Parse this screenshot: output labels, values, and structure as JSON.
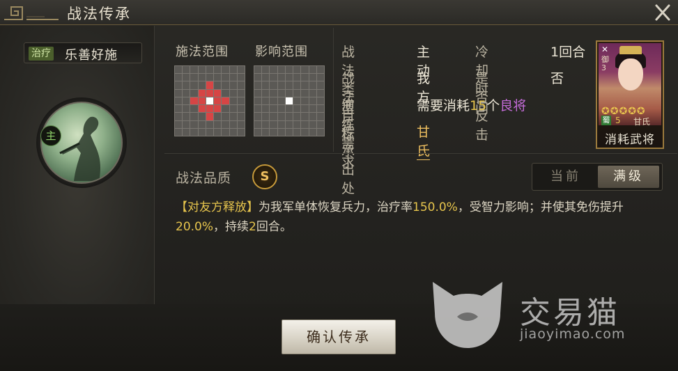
{
  "window": {
    "title": "战法传承"
  },
  "skill": {
    "type_tag": "治疗",
    "name": "乐善好施",
    "role_badge": "主"
  },
  "ranges": {
    "cast_label": "施法范围",
    "effect_label": "影响范围"
  },
  "info": {
    "rows": [
      {
        "key": "战法类型",
        "value": "主动",
        "key2": "冷却时间",
        "value2": "1回合"
      },
      {
        "key": "战法目标",
        "value": "我方",
        "key2": "是否反击",
        "value2": "否"
      },
      {
        "key": "演练需求",
        "value_prefix": "需要消耗",
        "value_count": "15",
        "value_unit": "个",
        "value_grade": "良将"
      },
      {
        "key": "传承出处",
        "value": "甘氏"
      }
    ]
  },
  "card": {
    "corner_mark": "✕",
    "side_text": "御3",
    "stars": "✪✪✪✪✪",
    "faction": "蜀",
    "level": "5",
    "general_name": "甘氏",
    "caption": "消耗武将"
  },
  "quality": {
    "label": "战法品质",
    "grade": "S"
  },
  "toggle": {
    "current_label": "当前",
    "max_label": "满级",
    "selected": "max"
  },
  "description": {
    "prefix": "【对友方释放】",
    "part1": "为我军单体恢复兵力，治疗率",
    "heal_rate": "150.0%",
    "part2": "，受智力影响；并使其免伤提升",
    "dmg_reduce": "20.0%",
    "part3": "，持续",
    "duration": "2",
    "part4": "回合。"
  },
  "actions": {
    "confirm_label": "确认传承"
  },
  "watermark": {
    "brand": "交易猫",
    "url": "jiaoyimao.com"
  },
  "colors": {
    "accent_gold": "#e7c54d",
    "grade_purple": "#c26bd6",
    "heal_green": "#4b5f2c",
    "range_red": "#d64545"
  }
}
